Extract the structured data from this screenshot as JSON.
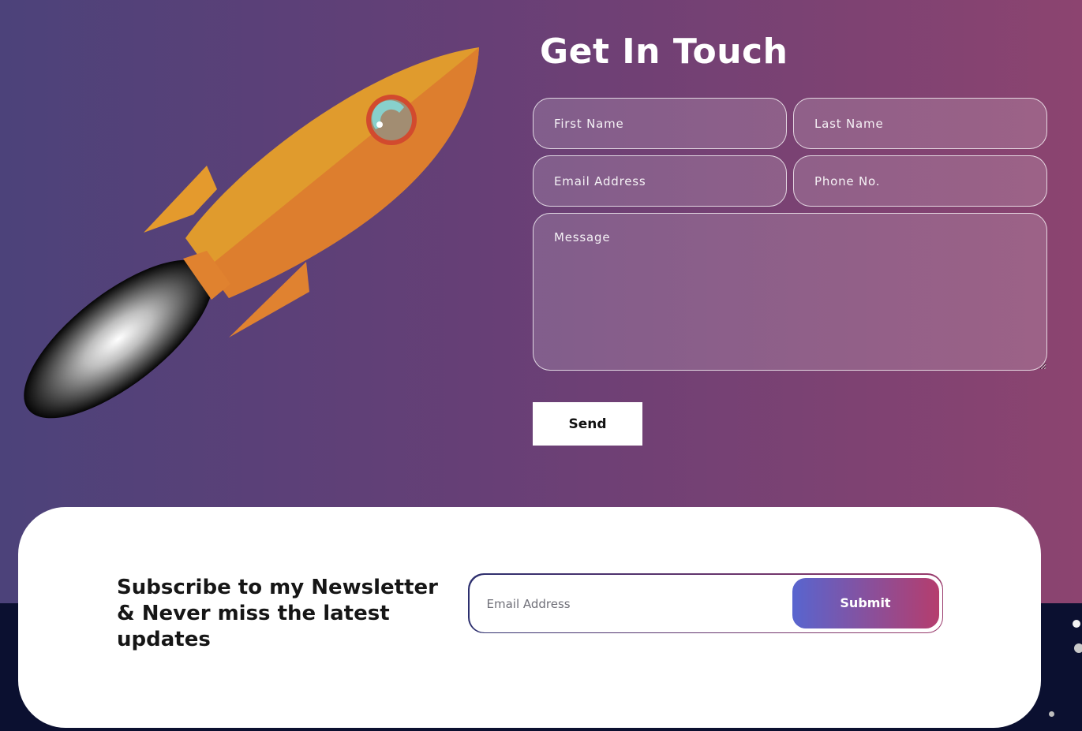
{
  "contact": {
    "title": "Get In Touch",
    "first_name_placeholder": "First Name",
    "last_name_placeholder": "Last Name",
    "email_placeholder": "Email Address",
    "phone_placeholder": "Phone No.",
    "message_placeholder": "Message",
    "send_label": "Send"
  },
  "newsletter": {
    "heading": "Subscribe to my Newsletter & Never miss the latest updates",
    "email_placeholder": "Email Address",
    "submit_label": "Submit"
  },
  "colors": {
    "hero_gradient_start": "#4c427a",
    "hero_gradient_end": "#8c4470",
    "rocket_body": "#e49a2d",
    "submit_gradient_start": "#5865cf",
    "submit_gradient_end": "#b53d6d",
    "footer_background": "#0b1030"
  },
  "icons": {
    "illustration": "rocket-illustration"
  }
}
